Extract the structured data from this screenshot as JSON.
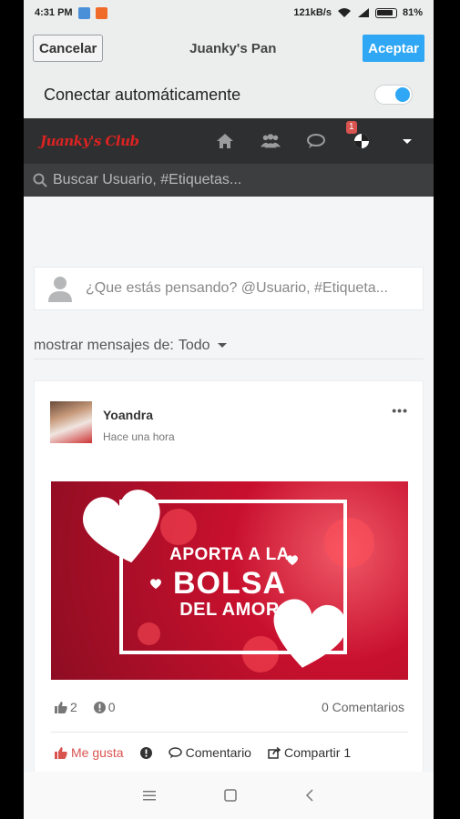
{
  "status_bar": {
    "time": "4:31 PM",
    "network_speed": "121kB/s",
    "battery": "81%"
  },
  "top_bar": {
    "cancel_label": "Cancelar",
    "title": "Juanky's Pan",
    "accept_label": "Aceptar"
  },
  "auto_connect": {
    "label": "Conectar automáticamente",
    "enabled": true
  },
  "nav": {
    "logo": "Juanky's Club",
    "notification_count": "1"
  },
  "search": {
    "placeholder": "Buscar Usuario, #Etiquetas..."
  },
  "composer": {
    "placeholder": "¿Que estás pensando? @Usuario, #Etiqueta..."
  },
  "filter": {
    "label": "mostrar mensajes de:",
    "value": "Todo"
  },
  "post": {
    "author": "Yoandra",
    "time": "Hace una hora",
    "banner": {
      "line1": "APORTA A LA",
      "line2": "BOLSA",
      "line3": "DEL AMOR"
    },
    "likes": "2",
    "reports": "0",
    "comments": "0 Comentarios",
    "actions": {
      "like": "Me gusta",
      "comment": "Comentario",
      "share": "Compartir 1"
    }
  },
  "colors": {
    "accent": "#2fa7f4",
    "navbar": "#2e2f30",
    "like": "#d9534f"
  }
}
